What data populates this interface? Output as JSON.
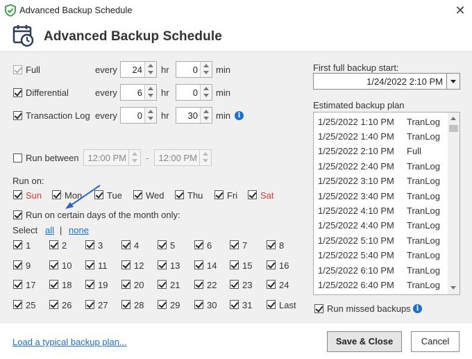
{
  "window": {
    "title": "Advanced Backup Schedule"
  },
  "header": {
    "title": "Advanced Backup Schedule"
  },
  "rows": [
    {
      "label": "Full",
      "every": "every",
      "value1": "24",
      "unit1": "hr",
      "value2": "0",
      "unit2": "min",
      "checked": true,
      "disabled": true
    },
    {
      "label": "Differential",
      "every": "every",
      "value1": "6",
      "unit1": "hr",
      "value2": "0",
      "unit2": "min",
      "checked": true,
      "disabled": false
    },
    {
      "label": "Transaction Log",
      "every": "every",
      "value1": "0",
      "unit1": "hr",
      "value2": "30",
      "unit2": "min",
      "checked": true,
      "disabled": false
    }
  ],
  "run_between": {
    "label": "Run between",
    "from": "12:00 PM",
    "separator": "-",
    "to": "12:00 PM",
    "checked": false
  },
  "run_on": {
    "label": "Run on:",
    "days": [
      {
        "label": "Sun",
        "checked": true,
        "weekend": true
      },
      {
        "label": "Mon",
        "checked": true,
        "weekend": false
      },
      {
        "label": "Tue",
        "checked": true,
        "weekend": false
      },
      {
        "label": "Wed",
        "checked": true,
        "weekend": false
      },
      {
        "label": "Thu",
        "checked": true,
        "weekend": false
      },
      {
        "label": "Fri",
        "checked": true,
        "weekend": false
      },
      {
        "label": "Sat",
        "checked": true,
        "weekend": true
      }
    ]
  },
  "month_days": {
    "label": "Run on certain days of the month only:",
    "checked": true,
    "select_label": "Select",
    "all_link": "all",
    "divider": "|",
    "none_link": "none",
    "days": [
      "1",
      "2",
      "3",
      "4",
      "5",
      "6",
      "7",
      "8",
      "9",
      "10",
      "11",
      "12",
      "13",
      "14",
      "15",
      "16",
      "17",
      "18",
      "19",
      "20",
      "21",
      "22",
      "23",
      "24",
      "25",
      "26",
      "27",
      "28",
      "29",
      "30",
      "31",
      "Last"
    ]
  },
  "first_backup": {
    "label": "First full backup start:",
    "value": "1/24/2022 2:10 PM"
  },
  "plan": {
    "label": "Estimated backup plan",
    "rows": [
      {
        "time": "1/25/2022 1:10 PM",
        "kind": "TranLog"
      },
      {
        "time": "1/25/2022 1:40 PM",
        "kind": "TranLog"
      },
      {
        "time": "1/25/2022 2:10 PM",
        "kind": "Full"
      },
      {
        "time": "1/25/2022 2:40 PM",
        "kind": "TranLog"
      },
      {
        "time": "1/25/2022 3:10 PM",
        "kind": "TranLog"
      },
      {
        "time": "1/25/2022 3:40 PM",
        "kind": "TranLog"
      },
      {
        "time": "1/25/2022 4:10 PM",
        "kind": "TranLog"
      },
      {
        "time": "1/25/2022 4:40 PM",
        "kind": "TranLog"
      },
      {
        "time": "1/25/2022 5:10 PM",
        "kind": "TranLog"
      },
      {
        "time": "1/25/2022 5:40 PM",
        "kind": "TranLog"
      },
      {
        "time": "1/25/2022 6:10 PM",
        "kind": "TranLog"
      },
      {
        "time": "1/25/2022 6:40 PM",
        "kind": "TranLog"
      }
    ]
  },
  "run_missed": {
    "label": "Run missed backups",
    "checked": true
  },
  "footer": {
    "load_link": "Load a typical backup plan...",
    "save_label": "Save & Close",
    "cancel_label": "Cancel"
  },
  "colors": {
    "accent": "#1a6fd1",
    "weekend": "#d63b30",
    "brand": "#2e9e3e",
    "arrow": "#2d64c4"
  },
  "icons": {
    "app": "shield-check-icon",
    "header": "calendar-clock-icon",
    "info": "info-icon",
    "close": "close-icon"
  }
}
